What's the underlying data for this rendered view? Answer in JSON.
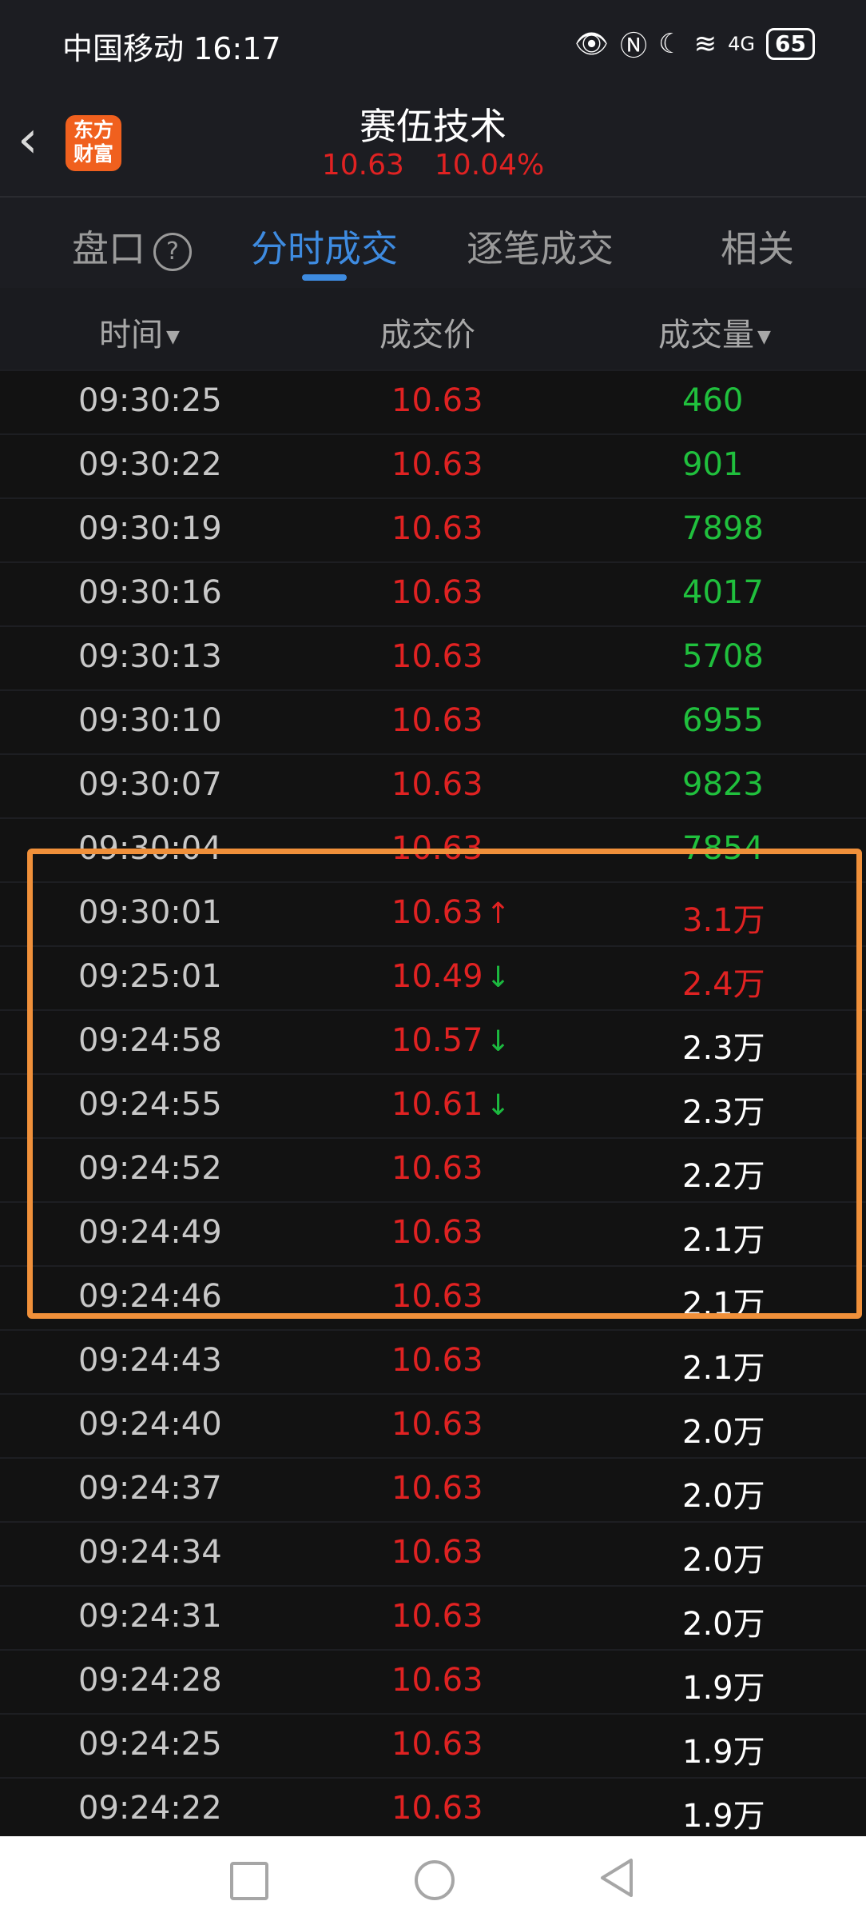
{
  "status_bar": {
    "carrier_time": "中国移动 16:17",
    "signal": "4G",
    "battery": "65"
  },
  "header": {
    "stock_name": "赛伍技术",
    "price": "10.63",
    "change_pct": "10.04%",
    "logo_line1": "东方",
    "logo_line2": "财富"
  },
  "tabs": [
    {
      "label": "盘口"
    },
    {
      "label": "分时成交"
    },
    {
      "label": "逐笔成交"
    },
    {
      "label": "相关"
    }
  ],
  "columns": {
    "time": "时间",
    "price": "成交价",
    "volume": "成交量"
  },
  "rows": [
    {
      "time": "09:30:25",
      "price": "10.63",
      "volume": "460",
      "vol_color": "green"
    },
    {
      "time": "09:30:22",
      "price": "10.63",
      "volume": "901",
      "vol_color": "green"
    },
    {
      "time": "09:30:19",
      "price": "10.63",
      "volume": "7898",
      "vol_color": "green"
    },
    {
      "time": "09:30:16",
      "price": "10.63",
      "volume": "4017",
      "vol_color": "green"
    },
    {
      "time": "09:30:13",
      "price": "10.63",
      "volume": "5708",
      "vol_color": "green"
    },
    {
      "time": "09:30:10",
      "price": "10.63",
      "volume": "6955",
      "vol_color": "green"
    },
    {
      "time": "09:30:07",
      "price": "10.63",
      "volume": "9823",
      "vol_color": "green"
    },
    {
      "time": "09:30:04",
      "price": "10.63",
      "volume": "7854",
      "vol_color": "green"
    },
    {
      "time": "09:30:01",
      "price": "10.63",
      "arrow": "↑",
      "volume": "3.1万",
      "vol_color": "red"
    },
    {
      "time": "09:25:01",
      "price": "10.49",
      "arrow": "↓",
      "volume": "2.4万",
      "vol_color": "red"
    },
    {
      "time": "09:24:58",
      "price": "10.57",
      "arrow": "↓",
      "volume": "2.3万",
      "vol_color": "white"
    },
    {
      "time": "09:24:55",
      "price": "10.61",
      "arrow": "↓",
      "volume": "2.3万",
      "vol_color": "white"
    },
    {
      "time": "09:24:52",
      "price": "10.63",
      "volume": "2.2万",
      "vol_color": "white"
    },
    {
      "time": "09:24:49",
      "price": "10.63",
      "volume": "2.1万",
      "vol_color": "white"
    },
    {
      "time": "09:24:46",
      "price": "10.63",
      "volume": "2.1万",
      "vol_color": "white"
    },
    {
      "time": "09:24:43",
      "price": "10.63",
      "volume": "2.1万",
      "vol_color": "white"
    },
    {
      "time": "09:24:40",
      "price": "10.63",
      "volume": "2.0万",
      "vol_color": "white"
    },
    {
      "time": "09:24:37",
      "price": "10.63",
      "volume": "2.0万",
      "vol_color": "white"
    },
    {
      "time": "09:24:34",
      "price": "10.63",
      "volume": "2.0万",
      "vol_color": "white"
    },
    {
      "time": "09:24:31",
      "price": "10.63",
      "volume": "2.0万",
      "vol_color": "white"
    },
    {
      "time": "09:24:28",
      "price": "10.63",
      "volume": "1.9万",
      "vol_color": "white"
    },
    {
      "time": "09:24:25",
      "price": "10.63",
      "volume": "1.9万",
      "vol_color": "white"
    },
    {
      "time": "09:24:22",
      "price": "10.63",
      "volume": "1.9万",
      "vol_color": "white"
    }
  ],
  "colors": {
    "up_red": "#e02222",
    "down_green": "#1cb83f",
    "accent_blue": "#3e8be0",
    "highlight_orange": "#f0903a"
  }
}
